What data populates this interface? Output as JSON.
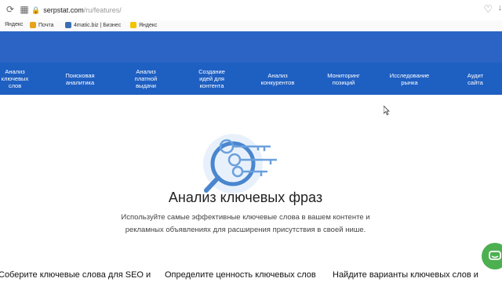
{
  "browser": {
    "url_host": "serpstat.com",
    "url_path": "/ru/features/",
    "bookmarks": [
      "Яндекс",
      "Почта",
      "4matic.biz | Бизнес",
      "Яндекс"
    ]
  },
  "menu": {
    "items": [
      "Анализ ключевых слов",
      "Поисковая аналитика",
      "Анализ платной выдачи",
      "Создание идей для контента",
      "Анализ конкурентов",
      "Мониторинг позиций",
      "Исследование рынка",
      "Аудит сайта"
    ]
  },
  "hero": {
    "title": "Анализ ключевых фраз",
    "description": "Используйте самые эффективные ключевые слова в вашем контенте и рекламных объявлениях для расширения присутствия в своей нише."
  },
  "features": [
    "Соберите ключевые слова для SEO и",
    "Определите ценность ключевых слов",
    "Найдите варианты ключевых слов и"
  ],
  "colors": {
    "header_blue": "#2b64c4",
    "menu_blue": "#1e5fc2",
    "chat_green": "#4cb050"
  }
}
